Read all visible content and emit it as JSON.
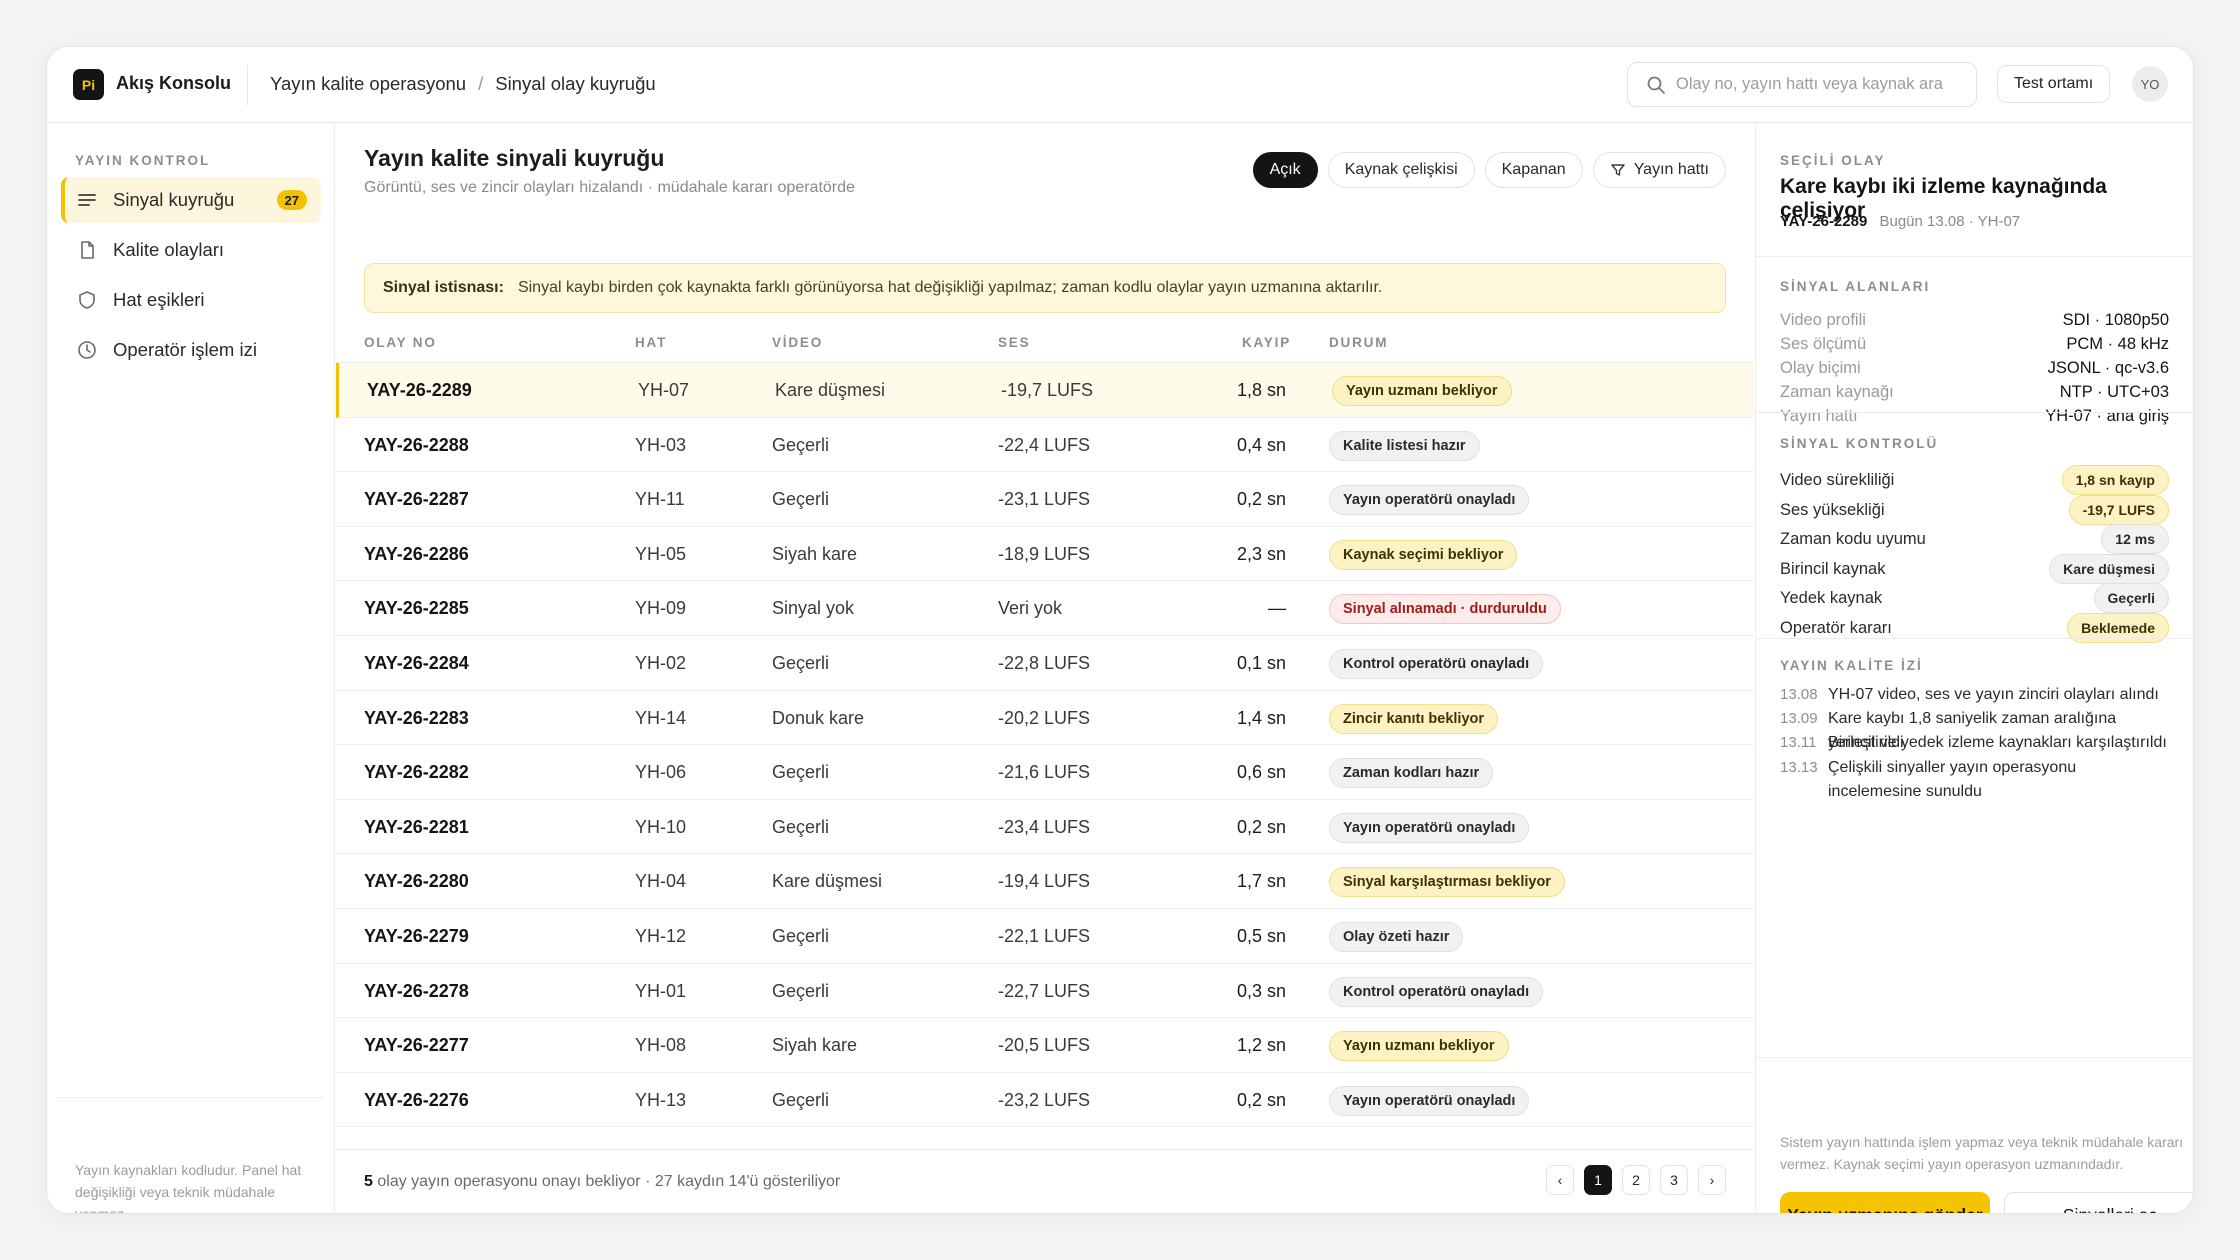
{
  "app": {
    "logo": "Pi",
    "name": "Akış Konsolu"
  },
  "breadcrumb": [
    "Yayın kalite operasyonu",
    "Sinyal olay kuyruğu"
  ],
  "search": {
    "placeholder": "Olay no, yayın hattı veya kaynak ara"
  },
  "env_button": "Test ortamı",
  "avatar": "YO",
  "sidebar": {
    "heading": "YAYIN KONTROL",
    "items": [
      {
        "label": "Sinyal kuyruğu",
        "icon": "list-icon",
        "badge": "27"
      },
      {
        "label": "Kalite olayları",
        "icon": "document-icon"
      },
      {
        "label": "Hat eşikleri",
        "icon": "shield-icon"
      },
      {
        "label": "Operatör işlem izi",
        "icon": "clock-icon"
      }
    ],
    "footer": "Yayın kaynakları kodludur. Panel hat değişikliği veya teknik müdahale yapmaz."
  },
  "main": {
    "title": "Yayın kalite sinyali kuyruğu",
    "subtitle": "Görüntü, ses ve zincir olayları hizalandı · müdahale kararı operatörde",
    "filters": [
      "Açık",
      "Kaynak çelişkisi",
      "Kapanan",
      "Yayın hattı"
    ],
    "notice_label": "Sinyal istisnası:",
    "notice_text": "Sinyal kaybı birden çok kaynakta farklı görünüyorsa hat değişikliği yapılmaz; zaman kodlu olaylar yayın uzmanına aktarılır.",
    "columns": [
      "OLAY NO",
      "HAT",
      "VİDEO",
      "SES",
      "KAYIP",
      "DURUM"
    ],
    "rows": [
      {
        "id": "YAY-26-2289",
        "line": "YH-07",
        "video": "Kare düşmesi",
        "audio": "-19,7 LUFS",
        "loss": "1,8 sn",
        "status": "Yayın uzmanı bekliyor",
        "tone": "warn"
      },
      {
        "id": "YAY-26-2288",
        "line": "YH-03",
        "video": "Geçerli",
        "audio": "-22,4 LUFS",
        "loss": "0,4 sn",
        "status": "Kalite listesi hazır",
        "tone": "ok"
      },
      {
        "id": "YAY-26-2287",
        "line": "YH-11",
        "video": "Geçerli",
        "audio": "-23,1 LUFS",
        "loss": "0,2 sn",
        "status": "Yayın operatörü onayladı",
        "tone": "ok"
      },
      {
        "id": "YAY-26-2286",
        "line": "YH-05",
        "video": "Siyah kare",
        "audio": "-18,9 LUFS",
        "loss": "2,3 sn",
        "status": "Kaynak seçimi bekliyor",
        "tone": "warn"
      },
      {
        "id": "YAY-26-2285",
        "line": "YH-09",
        "video": "Sinyal yok",
        "audio": "Veri yok",
        "loss": "—",
        "status": "Sinyal alınamadı · durduruldu",
        "tone": "err"
      },
      {
        "id": "YAY-26-2284",
        "line": "YH-02",
        "video": "Geçerli",
        "audio": "-22,8 LUFS",
        "loss": "0,1 sn",
        "status": "Kontrol operatörü onayladı",
        "tone": "ok"
      },
      {
        "id": "YAY-26-2283",
        "line": "YH-14",
        "video": "Donuk kare",
        "audio": "-20,2 LUFS",
        "loss": "1,4 sn",
        "status": "Zincir kanıtı bekliyor",
        "tone": "warn"
      },
      {
        "id": "YAY-26-2282",
        "line": "YH-06",
        "video": "Geçerli",
        "audio": "-21,6 LUFS",
        "loss": "0,6 sn",
        "status": "Zaman kodları hazır",
        "tone": "ok"
      },
      {
        "id": "YAY-26-2281",
        "line": "YH-10",
        "video": "Geçerli",
        "audio": "-23,4 LUFS",
        "loss": "0,2 sn",
        "status": "Yayın operatörü onayladı",
        "tone": "ok"
      },
      {
        "id": "YAY-26-2280",
        "line": "YH-04",
        "video": "Kare düşmesi",
        "audio": "-19,4 LUFS",
        "loss": "1,7 sn",
        "status": "Sinyal karşılaştırması bekliyor",
        "tone": "warn"
      },
      {
        "id": "YAY-26-2279",
        "line": "YH-12",
        "video": "Geçerli",
        "audio": "-22,1 LUFS",
        "loss": "0,5 sn",
        "status": "Olay özeti hazır",
        "tone": "ok"
      },
      {
        "id": "YAY-26-2278",
        "line": "YH-01",
        "video": "Geçerli",
        "audio": "-22,7 LUFS",
        "loss": "0,3 sn",
        "status": "Kontrol operatörü onayladı",
        "tone": "ok"
      },
      {
        "id": "YAY-26-2277",
        "line": "YH-08",
        "video": "Siyah kare",
        "audio": "-20,5 LUFS",
        "loss": "1,2 sn",
        "status": "Yayın uzmanı bekliyor",
        "tone": "warn"
      },
      {
        "id": "YAY-26-2276",
        "line": "YH-13",
        "video": "Geçerli",
        "audio": "-23,2 LUFS",
        "loss": "0,2 sn",
        "status": "Yayın operatörü onayladı",
        "tone": "ok"
      }
    ],
    "footer_count": "5",
    "footer_text": "olay yayın operasyonu onayı bekliyor · 27 kaydın 14'ü gösteriliyor",
    "pages": [
      "‹",
      "1",
      "2",
      "3",
      "›"
    ]
  },
  "panel": {
    "selected_heading": "SEÇİLİ OLAY",
    "title": "Kare kaybı iki izleme kaynağında çelişiyor",
    "id": "YAY-26-2289",
    "meta": "Bugün 13.08 · YH-07",
    "fields_heading": "SİNYAL ALANLARI",
    "fields": [
      {
        "k": "Video profili",
        "v": "SDI · 1080p50"
      },
      {
        "k": "Ses ölçümü",
        "v": "PCM · 48 kHz"
      },
      {
        "k": "Olay biçimi",
        "v": "JSONL · qc-v3.6"
      },
      {
        "k": "Zaman kaynağı",
        "v": "NTP · UTC+03"
      },
      {
        "k": "Yayın hattı",
        "v": "YH-07 · ana giriş"
      }
    ],
    "checks_heading": "SİNYAL KONTROLÜ",
    "checks": [
      {
        "k": "Video sürekliliği",
        "v": "1,8 sn kayıp",
        "tone": "warn"
      },
      {
        "k": "Ses yüksekliği",
        "v": "-19,7 LUFS",
        "tone": "warn"
      },
      {
        "k": "Zaman kodu uyumu",
        "v": "12 ms",
        "tone": "ok"
      },
      {
        "k": "Birincil kaynak",
        "v": "Kare düşmesi",
        "tone": "ok"
      },
      {
        "k": "Yedek kaynak",
        "v": "Geçerli",
        "tone": "ok"
      },
      {
        "k": "Operatör kararı",
        "v": "Beklemede",
        "tone": "warn"
      }
    ],
    "trace_heading": "YAYIN KALİTE İZİ",
    "trace": [
      {
        "t": "13.08",
        "text": "YH-07 video, ses ve yayın zinciri olayları alındı"
      },
      {
        "t": "13.09",
        "text": "Kare kaybı 1,8 saniyelik zaman aralığına yerleştirildi"
      },
      {
        "t": "13.11",
        "text": "Birincil ve yedek izleme kaynakları karşılaştırıldı"
      },
      {
        "t": "13.13",
        "text": "Çelişkili sinyaller yayın operasyonu incelemesine sunuldu"
      }
    ],
    "note": "Sistem yayın hattında işlem yapmaz veya teknik müdahale kararı vermez. Kaynak seçimi yayın operasyon uzmanındadır.",
    "primary_button": "Yayın uzmanına gönder",
    "secondary_button": "Sinyalleri aç"
  }
}
